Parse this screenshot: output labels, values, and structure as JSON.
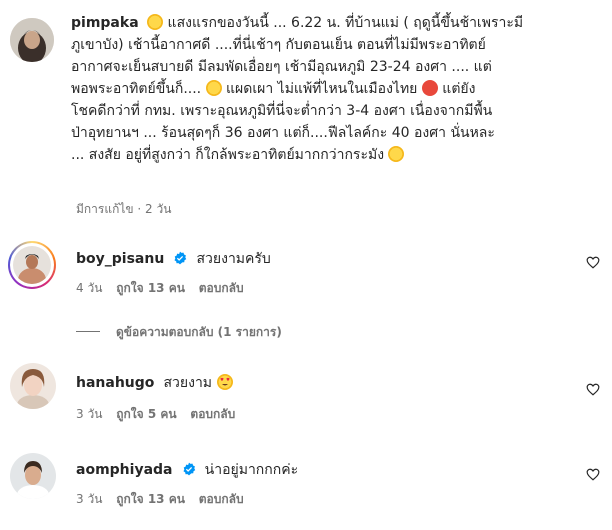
{
  "caption": {
    "username": "pimpaka",
    "lines": [
      "แสงแรกของวันนี้ ... 6.22 น. ที่บ้านแม่ ( ฤดูนี้ขึ้นช้าเพราะมี",
      "ภูเขาบัง) เช้านี้อากาศดี ....ที่นี่เช้าๆ กับตอนเย็น ตอนที่ไม่มีพระอาทิตย์",
      "อากาศจะเย็นสบายดี มีลมพัดเอื่อยๆ เช้ามีอุณหภูมิ 23-24 องศา .... แต่",
      "พอพระอาทิตย์ขึ้นก็....",
      "แผดเผา ไม่แพ้ที่ไหนในเมืองไทย",
      "แต่ยัง",
      "โชคดีกว่าที่ กทม. เพราะอุณหภูมิที่นี่จะต่ำกว่า 3-4 องศา เนื่องจากมีพื้น",
      "ป่าอุทยานฯ ... ร้อนสุดๆก็ 36 องศา แต่ก็....ฟีลไลค์กะ 40 องศา นั่นหละ",
      "... สงสัย อยู่ที่สูงกว่า ก็ใกล้พระอาทิตย์มากกว่ากระมัง"
    ],
    "meta": "มีการแก้ไข · 2 วัน"
  },
  "comments": [
    {
      "username": "boy_pisanu",
      "text": "สวยงามครับ",
      "time": "4 วัน",
      "likes": "ถูกใจ 13 คน",
      "reply": "ตอบกลับ",
      "verified": true
    },
    {
      "username": "hanahugo",
      "text": "สวยงาม",
      "time": "3 วัน",
      "likes": "ถูกใจ 5 คน",
      "reply": "ตอบกลับ",
      "verified": false
    },
    {
      "username": "aomphiyada",
      "text": "น่าอยู่มากกกค่ะ",
      "time": "3 วัน",
      "likes": "ถูกใจ 13 คน",
      "reply": "ตอบกลับ",
      "verified": true
    }
  ],
  "view_replies": "ดูข้อความตอบกลับ (1 รายการ)",
  "colors": {
    "text": "#262626",
    "meta": "#737373",
    "verified": "#0095f6"
  }
}
